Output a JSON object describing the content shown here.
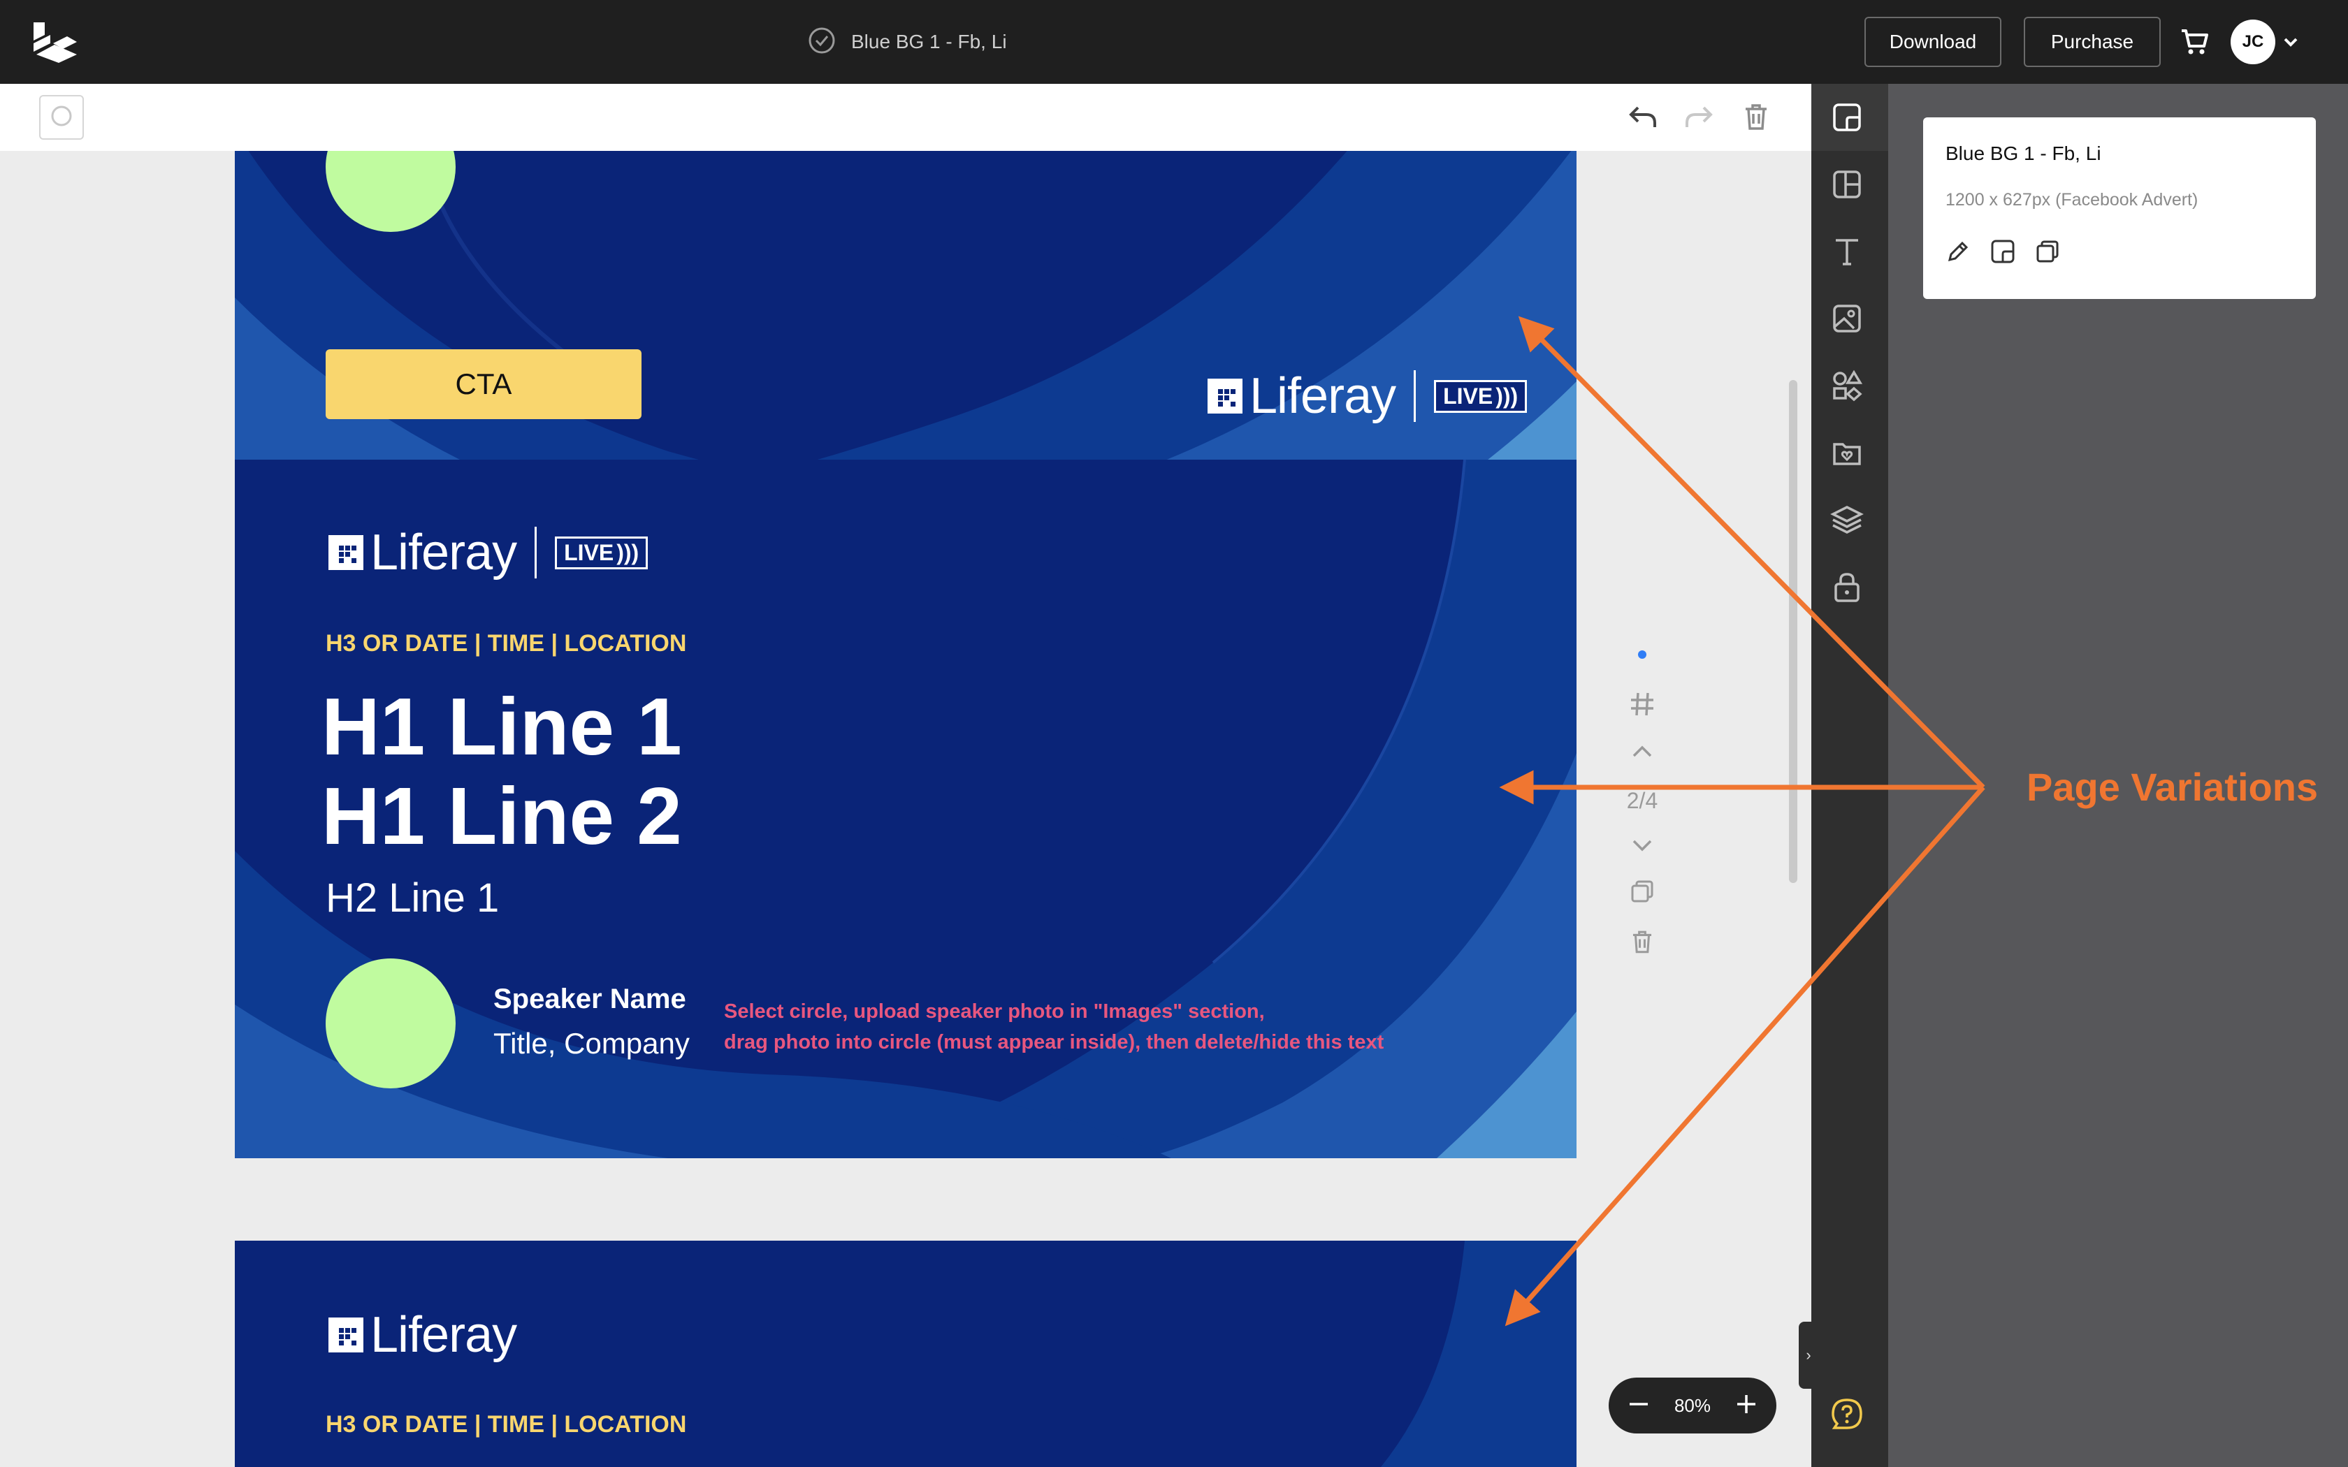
{
  "topbar": {
    "document_title": "Blue BG 1 - Fb, Li",
    "download_label": "Download",
    "purchase_label": "Purchase",
    "avatar_initials": "JC"
  },
  "pages": {
    "top_partial": {
      "cta_label": "CTA",
      "logo_text": "Liferay",
      "live_label": "LIVE"
    },
    "current": {
      "logo_text": "Liferay",
      "live_label": "LIVE",
      "h3": "H3 OR DATE | TIME | LOCATION",
      "h1_line1": "H1 Line 1",
      "h1_line2": "H1 Line 2",
      "h2": "H2 Line 1",
      "speaker_name": "Speaker Name",
      "speaker_title": "Title, Company",
      "hint_line1": "Select circle, upload speaker photo in \"Images\" section,",
      "hint_line2": "drag photo into circle (must appear inside), then delete/hide this text"
    },
    "bottom_partial": {
      "logo_text": "Liferay",
      "h3": "H3 OR DATE | TIME | LOCATION"
    }
  },
  "page_controls": {
    "counter": "2/4"
  },
  "zoom": {
    "level": "80%"
  },
  "side_panel": {
    "title": "Blue BG 1 - Fb, Li",
    "subtitle": "1200 x 627px (Facebook Advert)"
  },
  "annotation": {
    "label": "Page Variations"
  },
  "colors": {
    "page_bg": "#0a2478",
    "accent_yellow": "#f9d66e",
    "speaker_circle": "#c0fb9f",
    "hint_pink": "#e8577f",
    "annotation_orange": "#f07631"
  }
}
